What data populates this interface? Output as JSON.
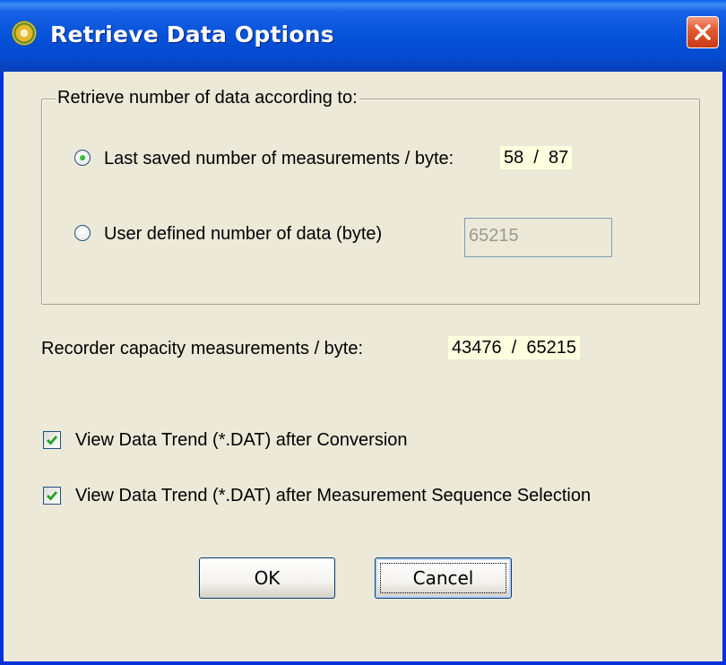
{
  "window": {
    "title": "Retrieve Data Options",
    "icon": "app-sun-icon",
    "close_icon": "close-icon"
  },
  "group": {
    "legend": "Retrieve number of data according to:",
    "options": [
      {
        "label": "Last saved number of measurements / byte:",
        "value": "58  /  87",
        "selected": true
      },
      {
        "label": "User defined number of data (byte)",
        "field_value": "65215",
        "selected": false
      }
    ]
  },
  "capacity": {
    "label": "Recorder capacity measurements / byte:",
    "value": "43476  /  65215"
  },
  "checkboxes": [
    {
      "label": "View Data Trend  (*.DAT) after Conversion",
      "checked": true
    },
    {
      "label": "View Data Trend  (*.DAT) after Measurement Sequence Selection",
      "checked": true
    }
  ],
  "buttons": {
    "ok": "OK",
    "cancel": "Cancel"
  },
  "colors": {
    "titlebar": "#0552d8",
    "dialog_bg": "#ece9d8",
    "value_highlight": "#ffffe0",
    "close_button": "#e35b33"
  }
}
